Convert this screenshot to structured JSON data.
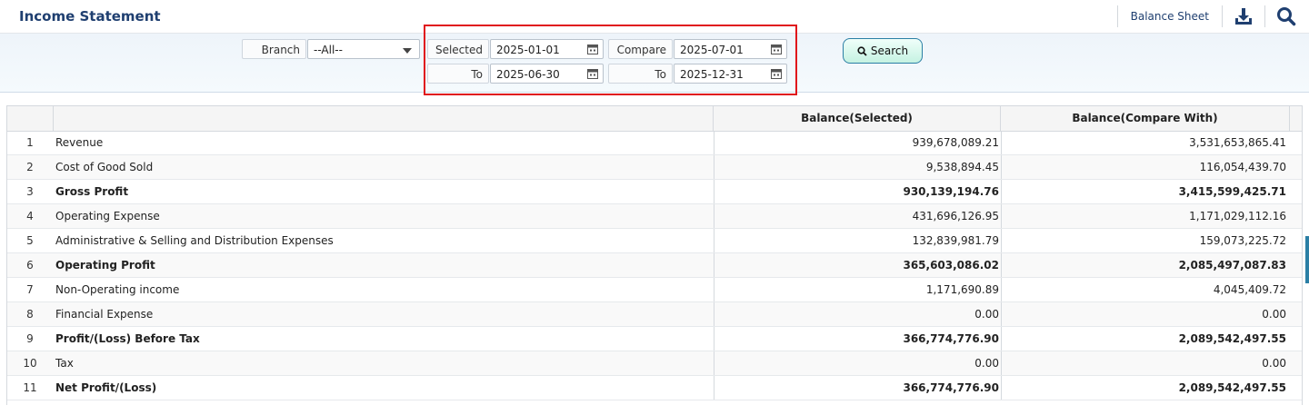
{
  "header": {
    "title": "Income Statement",
    "balance_sheet_label": "Balance Sheet",
    "icons": [
      "download-icon",
      "search-icon"
    ]
  },
  "filters": {
    "branch_label": "Branch",
    "branch_value": "--All--",
    "selected_label": "Selected",
    "selected_from": "2025-01-01",
    "selected_to_label": "To",
    "selected_to": "2025-06-30",
    "compare_label": "Compare",
    "compare_from": "2025-07-01",
    "compare_to_label": "To",
    "compare_to": "2025-12-31",
    "search_label": "Search"
  },
  "colors": {
    "accent": "#1f3f70",
    "highlight": "#e0151b",
    "button_border": "#2b7fa5"
  },
  "table": {
    "columns": [
      "",
      "",
      "Balance(Selected)",
      "Balance(Compare With)"
    ],
    "rows": [
      {
        "no": "1",
        "name": "Revenue",
        "selected": "939,678,089.21",
        "compare": "3,531,653,865.41",
        "bold": false
      },
      {
        "no": "2",
        "name": "Cost of Good Sold",
        "selected": "9,538,894.45",
        "compare": "116,054,439.70",
        "bold": false
      },
      {
        "no": "3",
        "name": "Gross Profit",
        "selected": "930,139,194.76",
        "compare": "3,415,599,425.71",
        "bold": true
      },
      {
        "no": "4",
        "name": "Operating Expense",
        "selected": "431,696,126.95",
        "compare": "1,171,029,112.16",
        "bold": false
      },
      {
        "no": "5",
        "name": "Administrative & Selling and Distribution Expenses",
        "selected": "132,839,981.79",
        "compare": "159,073,225.72",
        "bold": false
      },
      {
        "no": "6",
        "name": "Operating Profit",
        "selected": "365,603,086.02",
        "compare": "2,085,497,087.83",
        "bold": true
      },
      {
        "no": "7",
        "name": "Non-Operating income",
        "selected": "1,171,690.89",
        "compare": "4,045,409.72",
        "bold": false
      },
      {
        "no": "8",
        "name": "Financial Expense",
        "selected": "0.00",
        "compare": "0.00",
        "bold": false
      },
      {
        "no": "9",
        "name": "Profit/(Loss) Before Tax",
        "selected": "366,774,776.90",
        "compare": "2,089,542,497.55",
        "bold": true
      },
      {
        "no": "10",
        "name": "Tax",
        "selected": "0.00",
        "compare": "0.00",
        "bold": false
      },
      {
        "no": "11",
        "name": "Net Profit/(Loss)",
        "selected": "366,774,776.90",
        "compare": "2,089,542,497.55",
        "bold": true
      }
    ]
  }
}
